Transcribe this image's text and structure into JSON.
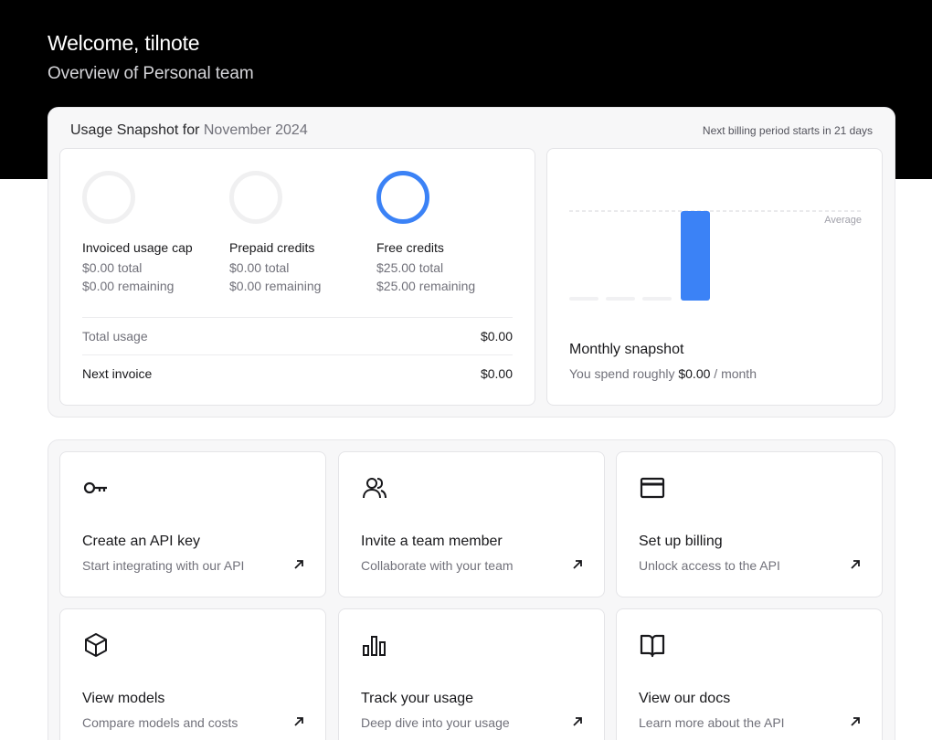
{
  "header": {
    "welcome": "Welcome, tilnote",
    "subtitle": "Overview of Personal team"
  },
  "snapshot": {
    "title_prefix": "Usage Snapshot for",
    "month": "November 2024",
    "billing_note": "Next billing period starts in 21 days",
    "credits": [
      {
        "name": "Invoiced usage cap",
        "total": "$0.00 total",
        "remaining": "$0.00 remaining",
        "icon": "ring-empty",
        "fill": 0
      },
      {
        "name": "Prepaid credits",
        "total": "$0.00 total",
        "remaining": "$0.00 remaining",
        "icon": "ring-empty",
        "fill": 0
      },
      {
        "name": "Free credits",
        "total": "$25.00 total",
        "remaining": "$25.00 remaining",
        "icon": "ring-full",
        "fill": 1
      }
    ],
    "total_usage": {
      "label": "Total usage",
      "value": "$0.00"
    },
    "next_invoice": {
      "label": "Next invoice",
      "value": "$0.00"
    },
    "monthly": {
      "title": "Monthly snapshot",
      "sub_prefix": "You spend roughly",
      "amount": "$0.00",
      "sub_suffix": "/ month",
      "average_label": "Average"
    },
    "colors": {
      "accent": "#3b82f6",
      "empty_ring": "#f0f0f1"
    }
  },
  "chart_data": {
    "type": "bar",
    "categories": [
      "",
      "",
      "",
      ""
    ],
    "values": [
      0,
      0,
      0,
      1
    ],
    "average": 1,
    "ylim": [
      0,
      1
    ]
  },
  "actions": [
    {
      "title": "Create an API key",
      "desc": "Start integrating with our API",
      "icon": "key-icon"
    },
    {
      "title": "Invite a team member",
      "desc": "Collaborate with your team",
      "icon": "users-icon"
    },
    {
      "title": "Set up billing",
      "desc": "Unlock access to the API",
      "icon": "credit-card-icon"
    },
    {
      "title": "View models",
      "desc": "Compare models and costs",
      "icon": "cube-icon"
    },
    {
      "title": "Track your usage",
      "desc": "Deep dive into your usage",
      "icon": "bar-chart-icon"
    },
    {
      "title": "View our docs",
      "desc": "Learn more about the API",
      "icon": "book-icon"
    }
  ]
}
